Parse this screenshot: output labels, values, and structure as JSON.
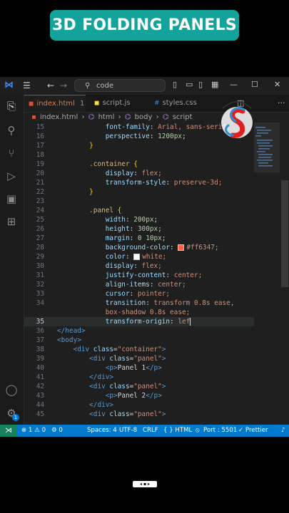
{
  "banner": {
    "title": "3D FOLDING PANELS"
  },
  "titlebar": {
    "command_center": "code"
  },
  "tabs": [
    {
      "label": "index.html",
      "badge": "1"
    },
    {
      "label": "script.js"
    },
    {
      "label": "styles.css"
    }
  ],
  "breadcrumb": [
    "index.html",
    "html",
    "body",
    "script"
  ],
  "editor": {
    "lines": [
      {
        "n": "15",
        "indent": "            ",
        "prop": "font-family",
        "val": "Arial, sans-serif;"
      },
      {
        "n": "16",
        "indent": "            ",
        "prop": "perspective",
        "num": "1200px",
        "end": ";"
      },
      {
        "n": "17",
        "indent": "        ",
        "brace": "}"
      },
      {
        "n": "18"
      },
      {
        "n": "19",
        "indent": "        ",
        "sel": ".container",
        "brace": " {"
      },
      {
        "n": "20",
        "indent": "            ",
        "prop": "display",
        "val": "flex;"
      },
      {
        "n": "21",
        "indent": "            ",
        "prop": "transform-style",
        "val": "preserve-3d;"
      },
      {
        "n": "22",
        "indent": "        ",
        "brace": "}"
      },
      {
        "n": "23"
      },
      {
        "n": "24",
        "indent": "        ",
        "sel": ".panel",
        "brace": " {"
      },
      {
        "n": "25",
        "indent": "            ",
        "prop": "width",
        "num": "200px",
        "end": ";"
      },
      {
        "n": "26",
        "indent": "            ",
        "prop": "height",
        "num": "300px",
        "end": ";"
      },
      {
        "n": "27",
        "indent": "            ",
        "prop": "margin",
        "num": "0 10px",
        "end": ";"
      },
      {
        "n": "28",
        "indent": "            ",
        "prop": "background-color",
        "val": "#ff6347;",
        "swatch": "#ff6347"
      },
      {
        "n": "29",
        "indent": "            ",
        "prop": "color",
        "val": "white;",
        "swatch": "#ffffff"
      },
      {
        "n": "30",
        "indent": "            ",
        "prop": "display",
        "val": "flex;"
      },
      {
        "n": "31",
        "indent": "            ",
        "prop": "justify-content",
        "val": "center;"
      },
      {
        "n": "32",
        "indent": "            ",
        "prop": "align-items",
        "val": "center;"
      },
      {
        "n": "33",
        "indent": "            ",
        "prop": "cursor",
        "val": "pointer;"
      },
      {
        "n": "34",
        "indent": "            ",
        "prop": "transition",
        "val": "transform 0.8s ease,",
        "numpart": "0.8s"
      },
      {
        "n": "",
        "indent": "            ",
        "cont": "box-shadow 0.8s ease;"
      },
      {
        "n": "35",
        "indent": "            ",
        "prop": "transform-origin",
        "val": "lef",
        "current": true
      },
      {
        "n": "36",
        "html": "</head>"
      },
      {
        "n": "37",
        "html": "<body>"
      },
      {
        "n": "38",
        "indent": "    ",
        "html": "<div class=\"container\">"
      },
      {
        "n": "39",
        "indent": "        ",
        "html": "<div class=\"panel\">"
      },
      {
        "n": "40",
        "indent": "            ",
        "html": "<p>Panel 1</p>"
      },
      {
        "n": "41",
        "indent": "        ",
        "html": "</div>"
      },
      {
        "n": "42",
        "indent": "        ",
        "html": "<div class=\"panel\">"
      },
      {
        "n": "43",
        "indent": "            ",
        "html": "<p>Panel 2</p>"
      },
      {
        "n": "44",
        "indent": "        ",
        "html": "</div>"
      },
      {
        "n": "45",
        "indent": "        ",
        "html": "<div class=\"panel\">"
      }
    ]
  },
  "statusbar": {
    "problems": "⊗ 1 ⚠ 0",
    "ports": "⚙ 0",
    "spaces": "Spaces: 4",
    "encoding": "UTF-8",
    "eol": "CRLF",
    "language": "{ } HTML",
    "live_server": "Port : 5501",
    "prettier": "✓ Prettier"
  },
  "account_badge": "1",
  "colors": {
    "banner": "#14a39a",
    "statusbar": "#007acc",
    "accent": "#e37933"
  }
}
